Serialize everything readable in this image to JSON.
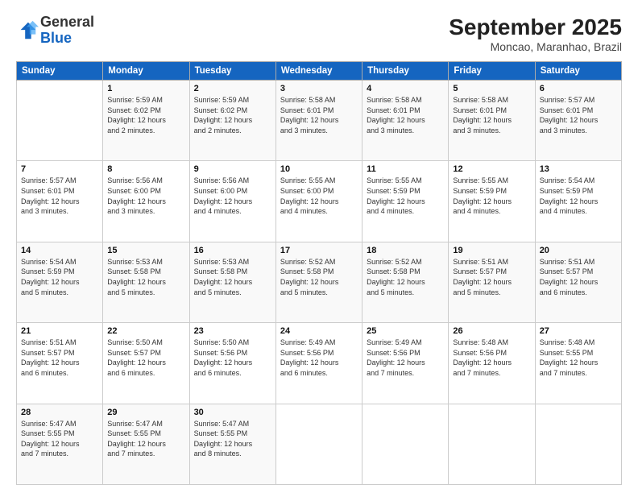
{
  "header": {
    "logo_line1": "General",
    "logo_line2": "Blue",
    "title": "September 2025",
    "subtitle": "Moncao, Maranhao, Brazil"
  },
  "calendar": {
    "days_of_week": [
      "Sunday",
      "Monday",
      "Tuesday",
      "Wednesday",
      "Thursday",
      "Friday",
      "Saturday"
    ],
    "weeks": [
      [
        {
          "day": "",
          "info": ""
        },
        {
          "day": "1",
          "info": "Sunrise: 5:59 AM\nSunset: 6:02 PM\nDaylight: 12 hours\nand 2 minutes."
        },
        {
          "day": "2",
          "info": "Sunrise: 5:59 AM\nSunset: 6:02 PM\nDaylight: 12 hours\nand 2 minutes."
        },
        {
          "day": "3",
          "info": "Sunrise: 5:58 AM\nSunset: 6:01 PM\nDaylight: 12 hours\nand 3 minutes."
        },
        {
          "day": "4",
          "info": "Sunrise: 5:58 AM\nSunset: 6:01 PM\nDaylight: 12 hours\nand 3 minutes."
        },
        {
          "day": "5",
          "info": "Sunrise: 5:58 AM\nSunset: 6:01 PM\nDaylight: 12 hours\nand 3 minutes."
        },
        {
          "day": "6",
          "info": "Sunrise: 5:57 AM\nSunset: 6:01 PM\nDaylight: 12 hours\nand 3 minutes."
        }
      ],
      [
        {
          "day": "7",
          "info": "Sunrise: 5:57 AM\nSunset: 6:01 PM\nDaylight: 12 hours\nand 3 minutes."
        },
        {
          "day": "8",
          "info": "Sunrise: 5:56 AM\nSunset: 6:00 PM\nDaylight: 12 hours\nand 3 minutes."
        },
        {
          "day": "9",
          "info": "Sunrise: 5:56 AM\nSunset: 6:00 PM\nDaylight: 12 hours\nand 4 minutes."
        },
        {
          "day": "10",
          "info": "Sunrise: 5:55 AM\nSunset: 6:00 PM\nDaylight: 12 hours\nand 4 minutes."
        },
        {
          "day": "11",
          "info": "Sunrise: 5:55 AM\nSunset: 5:59 PM\nDaylight: 12 hours\nand 4 minutes."
        },
        {
          "day": "12",
          "info": "Sunrise: 5:55 AM\nSunset: 5:59 PM\nDaylight: 12 hours\nand 4 minutes."
        },
        {
          "day": "13",
          "info": "Sunrise: 5:54 AM\nSunset: 5:59 PM\nDaylight: 12 hours\nand 4 minutes."
        }
      ],
      [
        {
          "day": "14",
          "info": "Sunrise: 5:54 AM\nSunset: 5:59 PM\nDaylight: 12 hours\nand 5 minutes."
        },
        {
          "day": "15",
          "info": "Sunrise: 5:53 AM\nSunset: 5:58 PM\nDaylight: 12 hours\nand 5 minutes."
        },
        {
          "day": "16",
          "info": "Sunrise: 5:53 AM\nSunset: 5:58 PM\nDaylight: 12 hours\nand 5 minutes."
        },
        {
          "day": "17",
          "info": "Sunrise: 5:52 AM\nSunset: 5:58 PM\nDaylight: 12 hours\nand 5 minutes."
        },
        {
          "day": "18",
          "info": "Sunrise: 5:52 AM\nSunset: 5:58 PM\nDaylight: 12 hours\nand 5 minutes."
        },
        {
          "day": "19",
          "info": "Sunrise: 5:51 AM\nSunset: 5:57 PM\nDaylight: 12 hours\nand 5 minutes."
        },
        {
          "day": "20",
          "info": "Sunrise: 5:51 AM\nSunset: 5:57 PM\nDaylight: 12 hours\nand 6 minutes."
        }
      ],
      [
        {
          "day": "21",
          "info": "Sunrise: 5:51 AM\nSunset: 5:57 PM\nDaylight: 12 hours\nand 6 minutes."
        },
        {
          "day": "22",
          "info": "Sunrise: 5:50 AM\nSunset: 5:57 PM\nDaylight: 12 hours\nand 6 minutes."
        },
        {
          "day": "23",
          "info": "Sunrise: 5:50 AM\nSunset: 5:56 PM\nDaylight: 12 hours\nand 6 minutes."
        },
        {
          "day": "24",
          "info": "Sunrise: 5:49 AM\nSunset: 5:56 PM\nDaylight: 12 hours\nand 6 minutes."
        },
        {
          "day": "25",
          "info": "Sunrise: 5:49 AM\nSunset: 5:56 PM\nDaylight: 12 hours\nand 7 minutes."
        },
        {
          "day": "26",
          "info": "Sunrise: 5:48 AM\nSunset: 5:56 PM\nDaylight: 12 hours\nand 7 minutes."
        },
        {
          "day": "27",
          "info": "Sunrise: 5:48 AM\nSunset: 5:55 PM\nDaylight: 12 hours\nand 7 minutes."
        }
      ],
      [
        {
          "day": "28",
          "info": "Sunrise: 5:47 AM\nSunset: 5:55 PM\nDaylight: 12 hours\nand 7 minutes."
        },
        {
          "day": "29",
          "info": "Sunrise: 5:47 AM\nSunset: 5:55 PM\nDaylight: 12 hours\nand 7 minutes."
        },
        {
          "day": "30",
          "info": "Sunrise: 5:47 AM\nSunset: 5:55 PM\nDaylight: 12 hours\nand 8 minutes."
        },
        {
          "day": "",
          "info": ""
        },
        {
          "day": "",
          "info": ""
        },
        {
          "day": "",
          "info": ""
        },
        {
          "day": "",
          "info": ""
        }
      ]
    ]
  }
}
